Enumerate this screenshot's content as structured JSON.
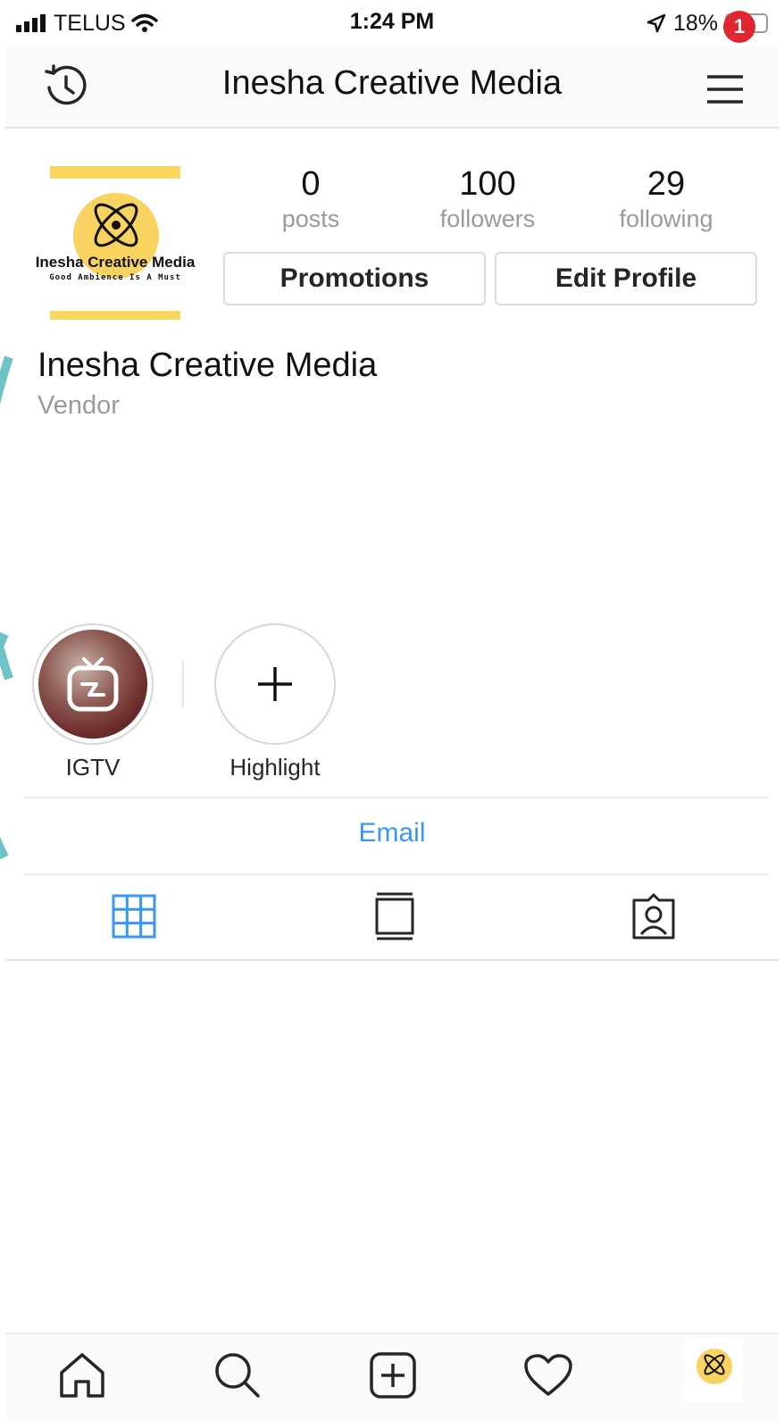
{
  "status_bar": {
    "carrier": "TELUS",
    "time": "1:24 PM",
    "battery": "18%",
    "battery_level": 0.18
  },
  "header": {
    "title": "Inesha Creative Media",
    "notification_count": "1"
  },
  "profile": {
    "avatar_logo_text": "Inesha Creative Media",
    "avatar_logo_tagline": "Good Ambience Is A Must",
    "stats": [
      {
        "value": "0",
        "label": "posts"
      },
      {
        "value": "100",
        "label": "followers"
      },
      {
        "value": "29",
        "label": "following"
      }
    ],
    "buttons": {
      "promotions": "Promotions",
      "edit_profile": "Edit Profile"
    },
    "name": "Inesha Creative Media",
    "category": "Vendor"
  },
  "highlights": [
    {
      "label": "IGTV"
    },
    {
      "label": "Highlight"
    }
  ],
  "contact": {
    "email_label": "Email"
  },
  "tabs": [
    {
      "icon": "grid-icon",
      "active": true
    },
    {
      "icon": "feed-icon",
      "active": false
    },
    {
      "icon": "tagged-icon",
      "active": false
    }
  ],
  "bottom_nav": [
    {
      "icon": "home-icon"
    },
    {
      "icon": "search-icon"
    },
    {
      "icon": "add-post-icon"
    },
    {
      "icon": "heart-icon"
    },
    {
      "icon": "profile-avatar-icon"
    }
  ],
  "colors": {
    "accent_blue": "#3897f0",
    "badge_red": "#e0262f",
    "logo_yellow": "#f8d35f",
    "muted_text": "#9a9a9a"
  }
}
